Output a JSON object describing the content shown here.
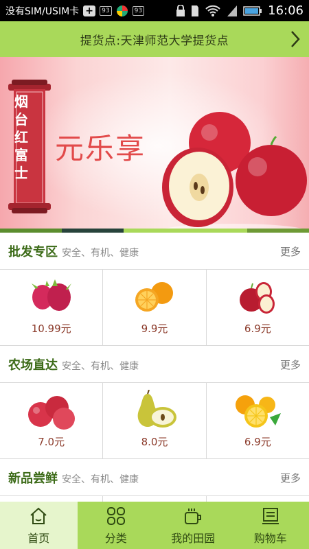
{
  "status_bar": {
    "carrier": "没有SIM/USIM卡",
    "badge_a": "93",
    "badge_b": "93",
    "time": "16:06"
  },
  "pickup": {
    "text": "提货点:天津师范大学提货点"
  },
  "banner": {
    "scroll_text": "烟台红富士",
    "slogan": "元乐享"
  },
  "sections": [
    {
      "title": "批发专区",
      "tags": "安全、有机、健康",
      "more": "更多",
      "items": [
        {
          "icon": "dragon-fruit-icon",
          "price": "10.99元"
        },
        {
          "icon": "orange-icon",
          "price": "9.9元"
        },
        {
          "icon": "apple-icon",
          "price": "6.9元"
        }
      ]
    },
    {
      "title": "农场直达",
      "tags": "安全、有机、健康",
      "more": "更多",
      "items": [
        {
          "icon": "apples-icon",
          "price": "7.0元"
        },
        {
          "icon": "pear-icon",
          "price": "8.0元"
        },
        {
          "icon": "citrus-icon",
          "price": "6.9元"
        }
      ]
    },
    {
      "title": "新品尝鲜",
      "tags": "安全、有机、健康",
      "more": "更多",
      "items": []
    }
  ],
  "bottom_nav": [
    {
      "label": "首页",
      "icon": "home-icon",
      "active": true
    },
    {
      "label": "分类",
      "icon": "category-icon",
      "active": false
    },
    {
      "label": "我的田园",
      "icon": "garden-icon",
      "active": false
    },
    {
      "label": "购物车",
      "icon": "cart-icon",
      "active": false
    }
  ],
  "colors": {
    "accent_green": "#a9d95a",
    "title_green": "#3c6b18",
    "price_red": "#8b3a2a",
    "slogan_red": "#e24a4a"
  }
}
